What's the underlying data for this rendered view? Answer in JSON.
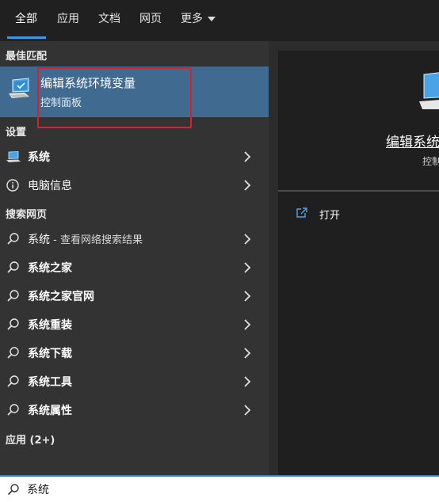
{
  "tabs": [
    {
      "label": "全部",
      "active": true
    },
    {
      "label": "应用"
    },
    {
      "label": "文档"
    },
    {
      "label": "网页"
    },
    {
      "label": "更多"
    }
  ],
  "sections": {
    "best_match": "最佳匹配",
    "settings": "设置",
    "web": "搜索网页",
    "apps": "应用 (2+)"
  },
  "best_match": {
    "title": "编辑系统环境变量",
    "subtitle": "控制面板",
    "icon": "monitor-check-icon"
  },
  "settings_items": [
    {
      "label": "系统",
      "icon": "laptop-icon"
    },
    {
      "label": "电脑信息",
      "icon": "info-icon"
    }
  ],
  "web_items": [
    {
      "label": "系统",
      "suffix": " - 查看网络搜索结果"
    },
    {
      "label": "系统之家"
    },
    {
      "label": "系统之家官网"
    },
    {
      "label": "系统重装"
    },
    {
      "label": "系统下载"
    },
    {
      "label": "系统工具"
    },
    {
      "label": "系统属性"
    }
  ],
  "preview": {
    "title": "编辑系统",
    "subtitle": "控制",
    "open_label": "打开"
  },
  "search": {
    "value": "系统"
  },
  "colors": {
    "accent": "#3b9ae8",
    "selection": "#406a8f",
    "highlight_box": "#d7202a"
  }
}
